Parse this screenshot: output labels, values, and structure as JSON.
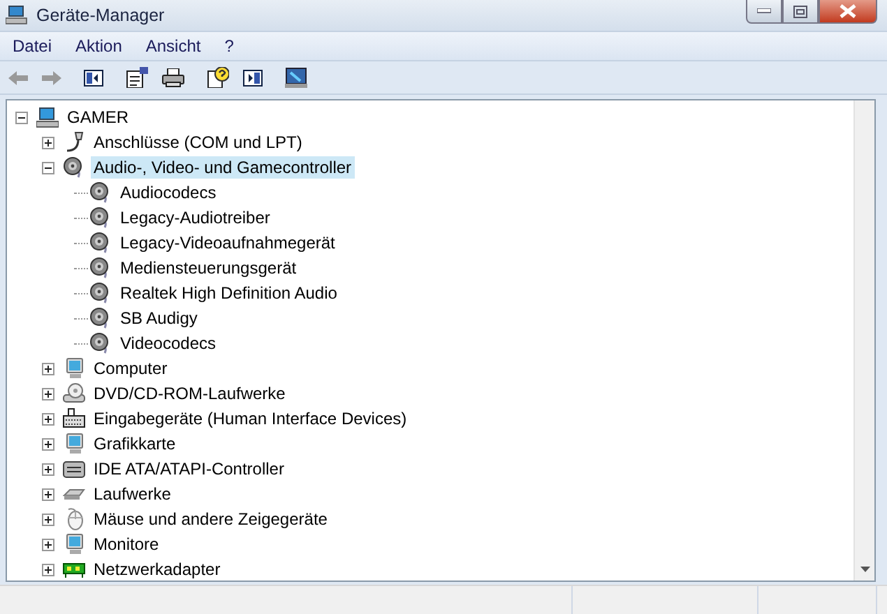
{
  "window": {
    "title": "Geräte-Manager"
  },
  "menu": [
    "Datei",
    "Aktion",
    "Ansicht",
    "?"
  ],
  "tree": [
    {
      "label": "GAMER",
      "kind": "computer",
      "expanded": true,
      "selected": false,
      "children": [
        {
          "label": "Anschlüsse (COM und LPT)",
          "kind": "port",
          "expanded": false,
          "selected": false
        },
        {
          "label": "Audio-, Video- und Gamecontroller",
          "kind": "speaker",
          "expanded": true,
          "selected": true,
          "children": [
            {
              "label": "Audiocodecs",
              "kind": "speaker",
              "selected": false
            },
            {
              "label": "Legacy-Audiotreiber",
              "kind": "speaker",
              "selected": false
            },
            {
              "label": "Legacy-Videoaufnahmegerät",
              "kind": "speaker",
              "selected": false
            },
            {
              "label": "Mediensteuerungsgerät",
              "kind": "speaker",
              "selected": false
            },
            {
              "label": "Realtek High Definition Audio",
              "kind": "speaker",
              "selected": false
            },
            {
              "label": "SB Audigy",
              "kind": "speaker",
              "selected": false
            },
            {
              "label": "Videocodecs",
              "kind": "speaker",
              "selected": false
            }
          ]
        },
        {
          "label": "Computer",
          "kind": "monitor",
          "expanded": false,
          "selected": false
        },
        {
          "label": "DVD/CD-ROM-Laufwerke",
          "kind": "disc",
          "expanded": false,
          "selected": false
        },
        {
          "label": "Eingabegeräte (Human Interface Devices)",
          "kind": "keyboard",
          "expanded": false,
          "selected": false
        },
        {
          "label": "Grafikkarte",
          "kind": "monitor",
          "expanded": false,
          "selected": false
        },
        {
          "label": "IDE ATA/ATAPI-Controller",
          "kind": "controller",
          "expanded": false,
          "selected": false
        },
        {
          "label": "Laufwerke",
          "kind": "drive",
          "expanded": false,
          "selected": false
        },
        {
          "label": "Mäuse und andere Zeigegeräte",
          "kind": "mouse",
          "expanded": false,
          "selected": false
        },
        {
          "label": "Monitore",
          "kind": "monitor",
          "expanded": false,
          "selected": false
        },
        {
          "label": "Netzwerkadapter",
          "kind": "network",
          "expanded": false,
          "selected": false
        }
      ]
    }
  ]
}
